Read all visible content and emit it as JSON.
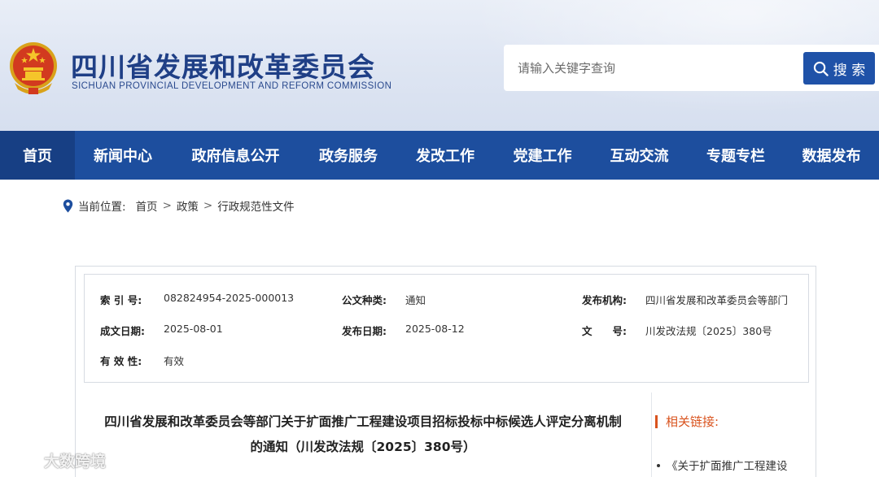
{
  "header": {
    "title": "四川省发展和改革委员会",
    "subtitle": "SICHUAN PROVINCIAL DEVELOPMENT AND REFORM COMMISSION",
    "emblem_icon": "national-emblem-icon"
  },
  "search": {
    "placeholder": "请输入关键字查询",
    "value": "",
    "button_label": "搜 索"
  },
  "nav": {
    "items": [
      {
        "label": "首页",
        "active": true
      },
      {
        "label": "新闻中心"
      },
      {
        "label": "政府信息公开"
      },
      {
        "label": "政务服务"
      },
      {
        "label": "发改工作"
      },
      {
        "label": "党建工作"
      },
      {
        "label": "互动交流"
      },
      {
        "label": "专题专栏"
      },
      {
        "label": "数据发布"
      }
    ]
  },
  "breadcrumb": {
    "prefix": "当前位置:",
    "items": [
      "首页",
      "政策",
      "行政规范性文件"
    ],
    "separator": ">"
  },
  "meta": {
    "index_label": "索 引 号:",
    "index_value": "082824954-2025-000013",
    "category_label": "公文种类:",
    "category_value": "通知",
    "publisher_label": "发布机构:",
    "publisher_value": "四川省发展和改革委员会等部门",
    "created_label": "成文日期:",
    "created_value": "2025-08-01",
    "published_label": "发布日期:",
    "published_value": "2025-08-12",
    "docno_label": "文　　号:",
    "docno_value": "川发改法规〔2025〕380号",
    "validity_label": "有 效 性:",
    "validity_value": "有效"
  },
  "document": {
    "title_line1": "四川省发展和改革委员会等部门关于扩面推广工程建设项目招标投标中标候选人评定分离机制",
    "title_line2": "的通知（川发改法规〔2025〕380号）"
  },
  "related": {
    "heading": "相关链接:",
    "items": [
      "《关于扩面推广工程建设"
    ]
  },
  "watermark": {
    "text": "大数跨境"
  },
  "colors": {
    "brand_blue": "#1d4e9e",
    "nav_active": "#173f84",
    "title_blue": "#1f3f86",
    "accent_orange": "#d9531e"
  }
}
